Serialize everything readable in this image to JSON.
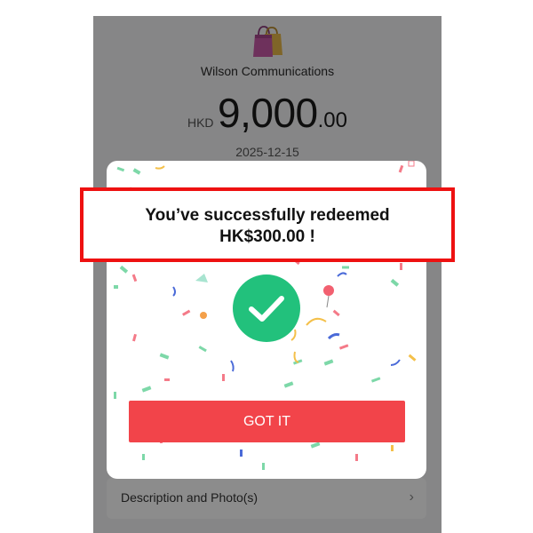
{
  "background": {
    "merchant_name": "Wilson Communications",
    "amount": {
      "currency": "HKD",
      "integer": "9,000",
      "decimal": ".00"
    },
    "date": "2025-12-15",
    "description_row": {
      "label": "Description and Photo(s)",
      "chevron": "›"
    },
    "icons": [
      "shopping-bags-icon",
      "chevron-right-icon"
    ]
  },
  "modal": {
    "message_line1": "You’ve successfully redeemed",
    "message_line2": "HK$300.00 !",
    "button_label": "GOT IT",
    "icons": [
      "checkmark-icon"
    ]
  },
  "colors": {
    "button": "#f2444a",
    "check_circle": "#22c17c",
    "highlight_border": "#ee1111",
    "overlay": "rgba(0,0,0,0.45)"
  }
}
